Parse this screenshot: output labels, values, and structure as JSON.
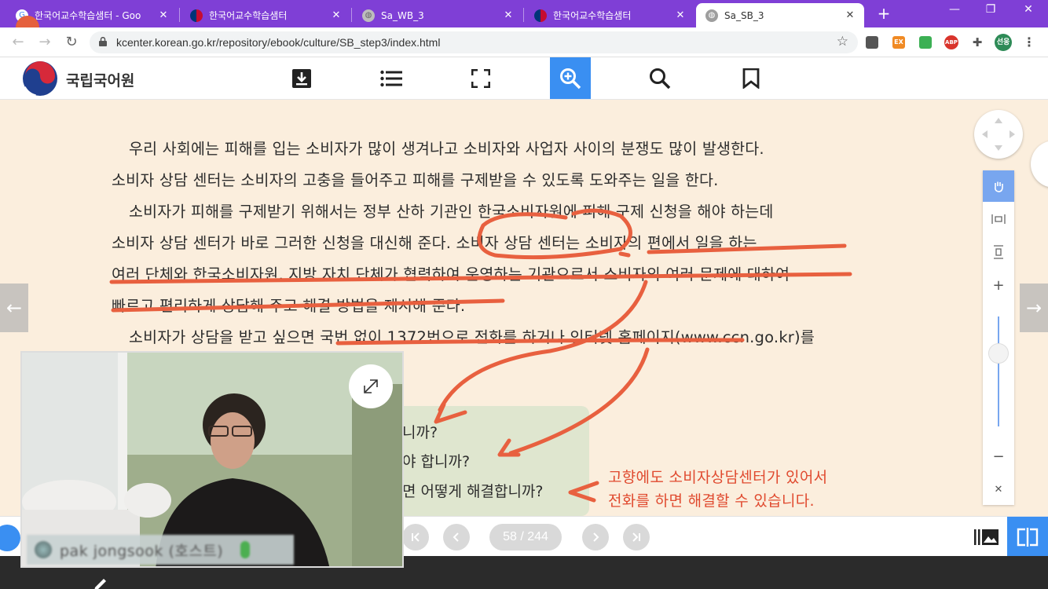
{
  "browser": {
    "tabs": [
      {
        "title": "한국어교수학습샘터 - Goo",
        "icon": "google-icon"
      },
      {
        "title": "한국어교수학습샘터",
        "icon": "korea-flag-icon"
      },
      {
        "title": "Sa_WB_3",
        "icon": "globe-icon"
      },
      {
        "title": "한국어교수학습샘터",
        "icon": "korea-flag-icon"
      },
      {
        "title": "Sa_SB_3",
        "icon": "globe-icon",
        "active": true
      }
    ],
    "url": "kcenter.korean.go.kr/repository/ebook/culture/SB_step3/index.html",
    "ext_ex": "EX",
    "ext_abp": "ABP",
    "profile": "선웅"
  },
  "ebook": {
    "logo_text": "국립국어원",
    "paragraphs": [
      "우리 사회에는 피해를 입는 소비자가 많이 생겨나고 소비자와 사업자 사이의 분쟁도 많이 발생한다.",
      "소비자 상담 센터는 소비자의 고충을 들어주고 피해를 구제받을 수 있도록 도와주는 일을 한다.",
      "소비자가 피해를 구제받기 위해서는 정부 산하 기관인 한국소비자원에 피해 구제 신청을 해야 하는데",
      "소비자 상담 센터가 바로 그러한 신청을 대신해 준다. 소비자 상담 센터는 소비자의 편에서 일을 하는",
      "여러 단체와 한국소비자원, 지방 자치 단체가 협력하여 운영하는 기관으로서 소비자의 여러 문제에 대하여",
      "빠르고 편리하게 상담해 주고 해결 방법을 제시해 준다.",
      "소비자가 상담을 받고 싶으면 국번 없이 1372번으로 전화를 하거나 인터넷 홈페이지(www.ccn.go.kr)를"
    ],
    "questions": [
      "니까?",
      "야 합니까?",
      "면 어떻게 해결합니까?"
    ],
    "answer": [
      "고향에도 소비자상담센터가 있어서",
      "전화를 하면 해결할 수 있습니다."
    ],
    "page_indicator": "58 / 244",
    "annotation_color": "#e8603f"
  },
  "video": {
    "participant_name": "pak jongsook (호스트)"
  }
}
